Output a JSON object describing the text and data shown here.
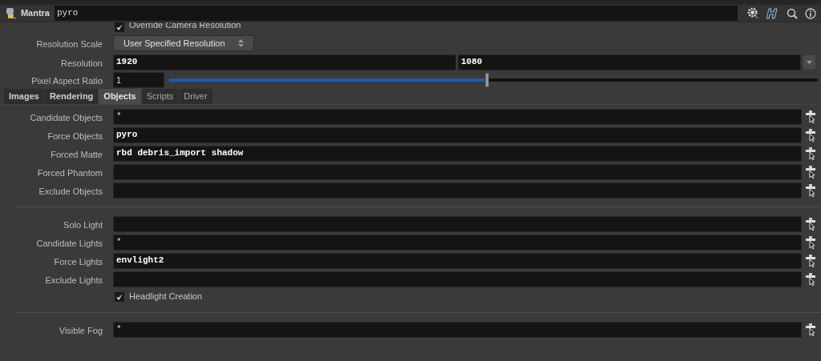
{
  "header": {
    "node_type": "Mantra",
    "node_name": "pyro"
  },
  "override": {
    "label": "Override Camera Resolution",
    "checked": true
  },
  "resolution_scale": {
    "label": "Resolution Scale",
    "value": "User Specified Resolution"
  },
  "resolution": {
    "label": "Resolution",
    "values": [
      "1920",
      "1080"
    ]
  },
  "pixel_aspect": {
    "label": "Pixel Aspect Ratio",
    "value": "1",
    "level": 0.49
  },
  "tabs": [
    {
      "label": "Images",
      "selected": false
    },
    {
      "label": "Rendering",
      "selected": false
    },
    {
      "label": "Objects",
      "selected": true
    },
    {
      "label": "Scripts",
      "selected": false
    },
    {
      "label": "Driver",
      "selected": false
    }
  ],
  "groups": [
    [
      {
        "kind": "field",
        "label": "Candidate Objects",
        "value": "*",
        "modified": false
      },
      {
        "kind": "field",
        "label": "Force Objects",
        "value": "pyro",
        "modified": true
      },
      {
        "kind": "field",
        "label": "Forced Matte",
        "value": "rbd debris_import shadow",
        "modified": true
      },
      {
        "kind": "field",
        "label": "Forced Phantom"
      },
      {
        "kind": "field",
        "label": "Exclude Objects"
      }
    ],
    [
      {
        "kind": "field",
        "label": "Solo Light"
      },
      {
        "kind": "field",
        "label": "Candidate Lights",
        "value": "*",
        "modified": false
      },
      {
        "kind": "field",
        "label": "Force Lights",
        "value": "envlight2",
        "modified": true
      },
      {
        "kind": "field",
        "label": "Exclude Lights"
      },
      {
        "kind": "checkbox",
        "label": "Headlight Creation",
        "checked": true
      }
    ],
    [
      {
        "kind": "field",
        "label": "Visible Fog",
        "value": "*",
        "modified": false
      }
    ]
  ]
}
